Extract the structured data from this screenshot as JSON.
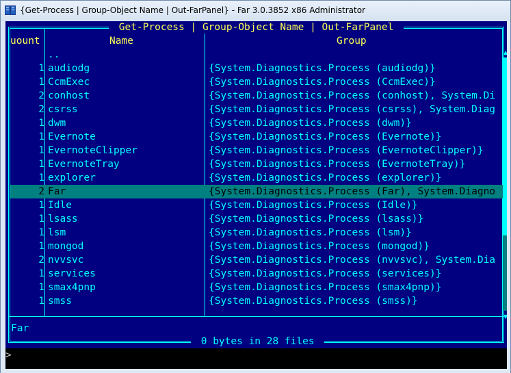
{
  "window": {
    "title": "{Get-Process | Group-Object Name | Out-FarPanel} - Far 3.0.3852 x86 Administrator"
  },
  "panel": {
    "title": " Get-Process | Group-Object Name | Out-FarPanel ",
    "footer": " 0 bytes in 28 files ",
    "columns": {
      "count": "uount",
      "name": "Name",
      "group": "Group"
    },
    "rows": [
      {
        "count": "",
        "name": "..",
        "group": ""
      },
      {
        "count": "1",
        "name": "audiodg",
        "group": "{System.Diagnostics.Process (audiodg)}"
      },
      {
        "count": "1",
        "name": "CcmExec",
        "group": "{System.Diagnostics.Process (CcmExec)}"
      },
      {
        "count": "2",
        "name": "conhost",
        "group": "{System.Diagnostics.Process (conhost), System.Di"
      },
      {
        "count": "2",
        "name": "csrss",
        "group": "{System.Diagnostics.Process (csrss), System.Diag"
      },
      {
        "count": "1",
        "name": "dwm",
        "group": "{System.Diagnostics.Process (dwm)}"
      },
      {
        "count": "1",
        "name": "Evernote",
        "group": "{System.Diagnostics.Process (Evernote)}"
      },
      {
        "count": "1",
        "name": "EvernoteClipper",
        "group": "{System.Diagnostics.Process (EvernoteClipper)}"
      },
      {
        "count": "1",
        "name": "EvernoteTray",
        "group": "{System.Diagnostics.Process (EvernoteTray)}"
      },
      {
        "count": "1",
        "name": "explorer",
        "group": "{System.Diagnostics.Process (explorer)}"
      },
      {
        "count": "2",
        "name": "Far",
        "group": "{System.Diagnostics.Process (Far), System.Diagno"
      },
      {
        "count": "1",
        "name": "Idle",
        "group": "{System.Diagnostics.Process (Idle)}"
      },
      {
        "count": "1",
        "name": "lsass",
        "group": "{System.Diagnostics.Process (lsass)}"
      },
      {
        "count": "1",
        "name": "lsm",
        "group": "{System.Diagnostics.Process (lsm)}"
      },
      {
        "count": "1",
        "name": "mongod",
        "group": "{System.Diagnostics.Process (mongod)}"
      },
      {
        "count": "2",
        "name": "nvvsvc",
        "group": "{System.Diagnostics.Process (nvvsvc), System.Dia"
      },
      {
        "count": "1",
        "name": "services",
        "group": "{System.Diagnostics.Process (services)}"
      },
      {
        "count": "1",
        "name": "smax4pnp",
        "group": "{System.Diagnostics.Process (smax4pnp)}"
      },
      {
        "count": "1",
        "name": "smss",
        "group": "{System.Diagnostics.Process (smss)}"
      }
    ],
    "selected_index": 10,
    "status": "Far",
    "scroll_up_arrow": "▲",
    "scroll_down_arrow": "▼"
  },
  "cmdline": {
    "prompt": ">"
  },
  "colors": {
    "panel_bg": "#000080",
    "text": "#00ffff",
    "header": "#ffff55",
    "selection": "#008080"
  }
}
